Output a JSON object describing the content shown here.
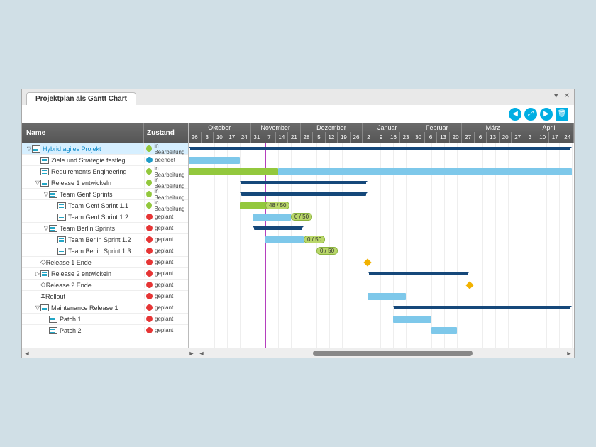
{
  "tab_title": "Projektplan als Gantt Chart",
  "columns": {
    "name": "Name",
    "state": "Zustand"
  },
  "tool_nav_left": "◀",
  "tool_zoom": "⤢",
  "tool_nav_right": "▶",
  "tool_delete": "🗑",
  "months": [
    {
      "label": "Oktober",
      "weeks": 5
    },
    {
      "label": "November",
      "weeks": 4
    },
    {
      "label": "Dezember",
      "weeks": 5
    },
    {
      "label": "Januar",
      "weeks": 4
    },
    {
      "label": "Februar",
      "weeks": 4
    },
    {
      "label": "März",
      "weeks": 5
    },
    {
      "label": "April",
      "weeks": 4
    }
  ],
  "day_labels": [
    "26",
    "3",
    "10",
    "17",
    "24",
    "31",
    "7",
    "14",
    "21",
    "28",
    "5",
    "12",
    "19",
    "26",
    "2",
    "9",
    "16",
    "23",
    "30",
    "6",
    "13",
    "20",
    "27",
    "6",
    "13",
    "20",
    "27",
    "3",
    "10",
    "17",
    "24"
  ],
  "rows": [
    {
      "name": "Hybrid agiles Projekt",
      "indent": 0,
      "toggle": "▽",
      "icon": "task",
      "state": "in Bearbeitung",
      "dot": "green",
      "selected": true,
      "kind": "summary",
      "start": 0,
      "end": 30
    },
    {
      "name": "Ziele und Strategie festleg...",
      "indent": 1,
      "toggle": "",
      "icon": "task",
      "state": "beendet",
      "dot": "blue",
      "selected": false,
      "kind": "done",
      "start": 0,
      "end": 4
    },
    {
      "name": "Requirements Engineering",
      "indent": 1,
      "toggle": "",
      "icon": "task",
      "state": "in Bearbeitung",
      "dot": "green",
      "selected": false,
      "kind": "active_long",
      "start": 0,
      "end": 30
    },
    {
      "name": "Release 1 entwickeln",
      "indent": 1,
      "toggle": "▽",
      "icon": "task",
      "state": "in Bearbeitung",
      "dot": "green",
      "selected": false,
      "kind": "summary",
      "start": 4,
      "end": 14
    },
    {
      "name": "Team Genf Sprints",
      "indent": 2,
      "toggle": "▽",
      "icon": "task",
      "state": "in Bearbeitung",
      "dot": "green",
      "selected": false,
      "kind": "summary",
      "start": 4,
      "end": 14
    },
    {
      "name": "Team Genf Sprint 1.1",
      "indent": 3,
      "toggle": "",
      "icon": "task",
      "state": "in Bearbeitung",
      "dot": "green",
      "selected": false,
      "kind": "active",
      "start": 4,
      "end": 7,
      "badge": "48 / 50",
      "badge_at": 6
    },
    {
      "name": "Team Genf Sprint 1.2",
      "indent": 3,
      "toggle": "",
      "icon": "task",
      "state": "geplant",
      "dot": "red",
      "selected": false,
      "kind": "plan",
      "start": 5,
      "end": 8,
      "badge": "0 / 50",
      "badge_at": 8
    },
    {
      "name": "Team Berlin Sprints",
      "indent": 2,
      "toggle": "▽",
      "icon": "task",
      "state": "geplant",
      "dot": "red",
      "selected": false,
      "kind": "summary",
      "start": 5,
      "end": 9
    },
    {
      "name": "Team Berlin Sprint 1.2",
      "indent": 3,
      "toggle": "",
      "icon": "task",
      "state": "geplant",
      "dot": "red",
      "selected": false,
      "kind": "plan",
      "start": 6,
      "end": 9,
      "badge": "0 / 50",
      "badge_at": 9
    },
    {
      "name": "Team Berlin Sprint 1.3",
      "indent": 3,
      "toggle": "",
      "icon": "task",
      "state": "geplant",
      "dot": "red",
      "selected": false,
      "kind": "plan",
      "badge": "0 / 50",
      "badge_at": 10
    },
    {
      "name": "Release 1 Ende",
      "indent": 1,
      "toggle": "",
      "icon": "milestone",
      "state": "geplant",
      "dot": "red",
      "selected": false,
      "kind": "ms",
      "ms_at": 14
    },
    {
      "name": "Release 2 entwickeln",
      "indent": 1,
      "toggle": "▷",
      "icon": "task",
      "state": "geplant",
      "dot": "red",
      "selected": false,
      "kind": "summary",
      "start": 14,
      "end": 22
    },
    {
      "name": "Release 2 Ende",
      "indent": 1,
      "toggle": "",
      "icon": "milestone",
      "state": "geplant",
      "dot": "red",
      "selected": false,
      "kind": "ms",
      "ms_at": 22
    },
    {
      "name": "Rollout",
      "indent": 1,
      "toggle": "",
      "icon": "rollout",
      "state": "geplant",
      "dot": "red",
      "selected": false,
      "kind": "plan",
      "start": 14,
      "end": 17
    },
    {
      "name": "Maintenance Release 1",
      "indent": 1,
      "toggle": "▽",
      "icon": "task",
      "state": "geplant",
      "dot": "red",
      "selected": false,
      "kind": "summary",
      "start": 16,
      "end": 30
    },
    {
      "name": "Patch 1",
      "indent": 2,
      "toggle": "",
      "icon": "task",
      "state": "geplant",
      "dot": "red",
      "selected": false,
      "kind": "plan",
      "start": 16,
      "end": 19
    },
    {
      "name": "Patch 2",
      "indent": 2,
      "toggle": "",
      "icon": "task",
      "state": "geplant",
      "dot": "red",
      "selected": false,
      "kind": "plan",
      "start": 19,
      "end": 21
    }
  ],
  "today_at": 6,
  "scroll": {
    "left_pct": 30,
    "width_pct": 45
  }
}
